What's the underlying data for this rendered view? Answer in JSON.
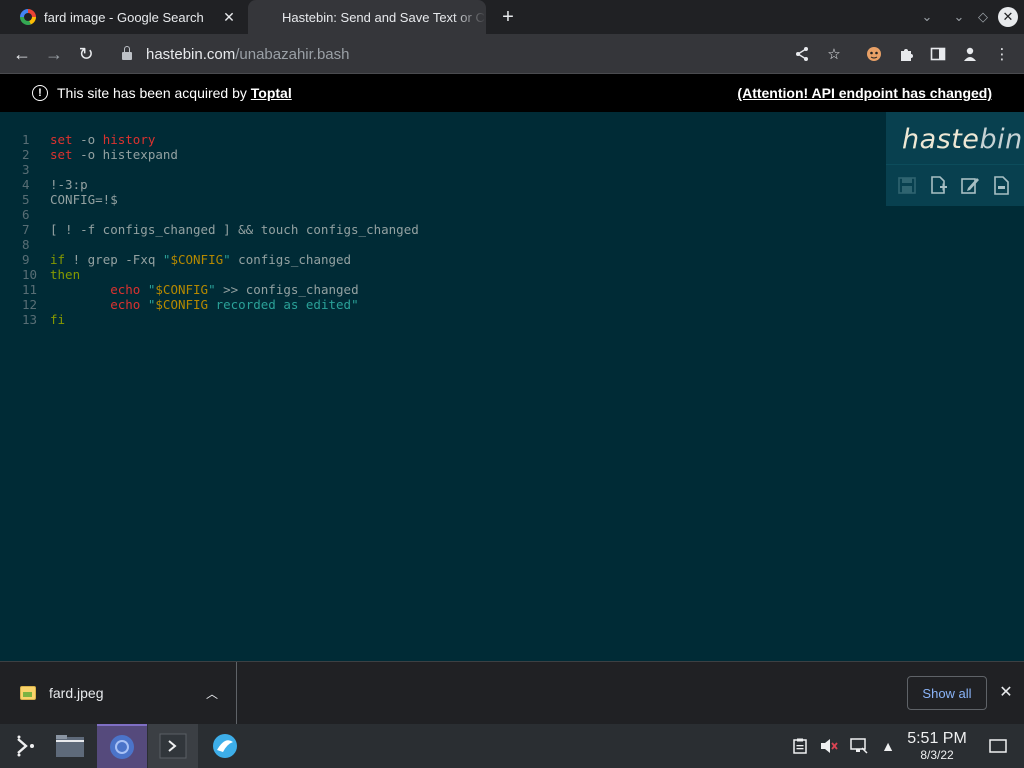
{
  "tabs": [
    {
      "title": "fard image - Google Search",
      "active": false
    },
    {
      "title": "Hastebin: Send and Save Text or Code Snippets",
      "active": true
    }
  ],
  "toolbar": {
    "url_host": "hastebin.com",
    "url_path": "/unabazahir.bash"
  },
  "banner": {
    "text": "This site has been acquired by",
    "link": "Toptal",
    "notice": "(Attention! API endpoint has changed)"
  },
  "hastebin": {
    "logo_bold": "haste",
    "logo_rest": "bin",
    "actions": [
      "save-icon",
      "new-icon",
      "duplicate-icon",
      "raw-icon"
    ]
  },
  "code": {
    "language": "bash",
    "lines": [
      {
        "n": "1",
        "segs": [
          [
            "kw",
            "set"
          ],
          [
            "src",
            " -o "
          ],
          [
            "kw",
            "history"
          ]
        ]
      },
      {
        "n": "2",
        "segs": [
          [
            "kw",
            "set"
          ],
          [
            "src",
            " -o histexpand"
          ]
        ]
      },
      {
        "n": "3",
        "segs": []
      },
      {
        "n": "4",
        "segs": [
          [
            "src",
            "!-3:p"
          ]
        ]
      },
      {
        "n": "5",
        "segs": [
          [
            "src",
            "CONFIG=!$"
          ]
        ]
      },
      {
        "n": "6",
        "segs": []
      },
      {
        "n": "7",
        "segs": [
          [
            "src",
            "[ ! -f configs_changed ] && touch configs_changed"
          ]
        ]
      },
      {
        "n": "8",
        "segs": []
      },
      {
        "n": "9",
        "segs": [
          [
            "kw2",
            "if"
          ],
          [
            "src",
            " ! grep -Fxq "
          ],
          [
            "str",
            "\""
          ],
          [
            "var",
            "$CONFIG"
          ],
          [
            "str",
            "\""
          ],
          [
            "src",
            " configs_changed"
          ]
        ]
      },
      {
        "n": "10",
        "segs": [
          [
            "kw2",
            "then"
          ]
        ]
      },
      {
        "n": "11",
        "segs": [
          [
            "src",
            "        "
          ],
          [
            "kw",
            "echo"
          ],
          [
            "src",
            " "
          ],
          [
            "str",
            "\""
          ],
          [
            "var",
            "$CONFIG"
          ],
          [
            "str",
            "\""
          ],
          [
            "src",
            " >> configs_changed"
          ]
        ]
      },
      {
        "n": "12",
        "segs": [
          [
            "src",
            "        "
          ],
          [
            "kw",
            "echo"
          ],
          [
            "src",
            " "
          ],
          [
            "str",
            "\""
          ],
          [
            "var",
            "$CONFIG"
          ],
          [
            "str",
            " recorded as edited\""
          ]
        ]
      },
      {
        "n": "13",
        "segs": [
          [
            "kw2",
            "fi"
          ]
        ]
      }
    ]
  },
  "downloads": {
    "file": "fard.jpeg",
    "show_all": "Show all"
  },
  "taskbar": {
    "time": "5:51 PM",
    "date": "8/3/22"
  }
}
